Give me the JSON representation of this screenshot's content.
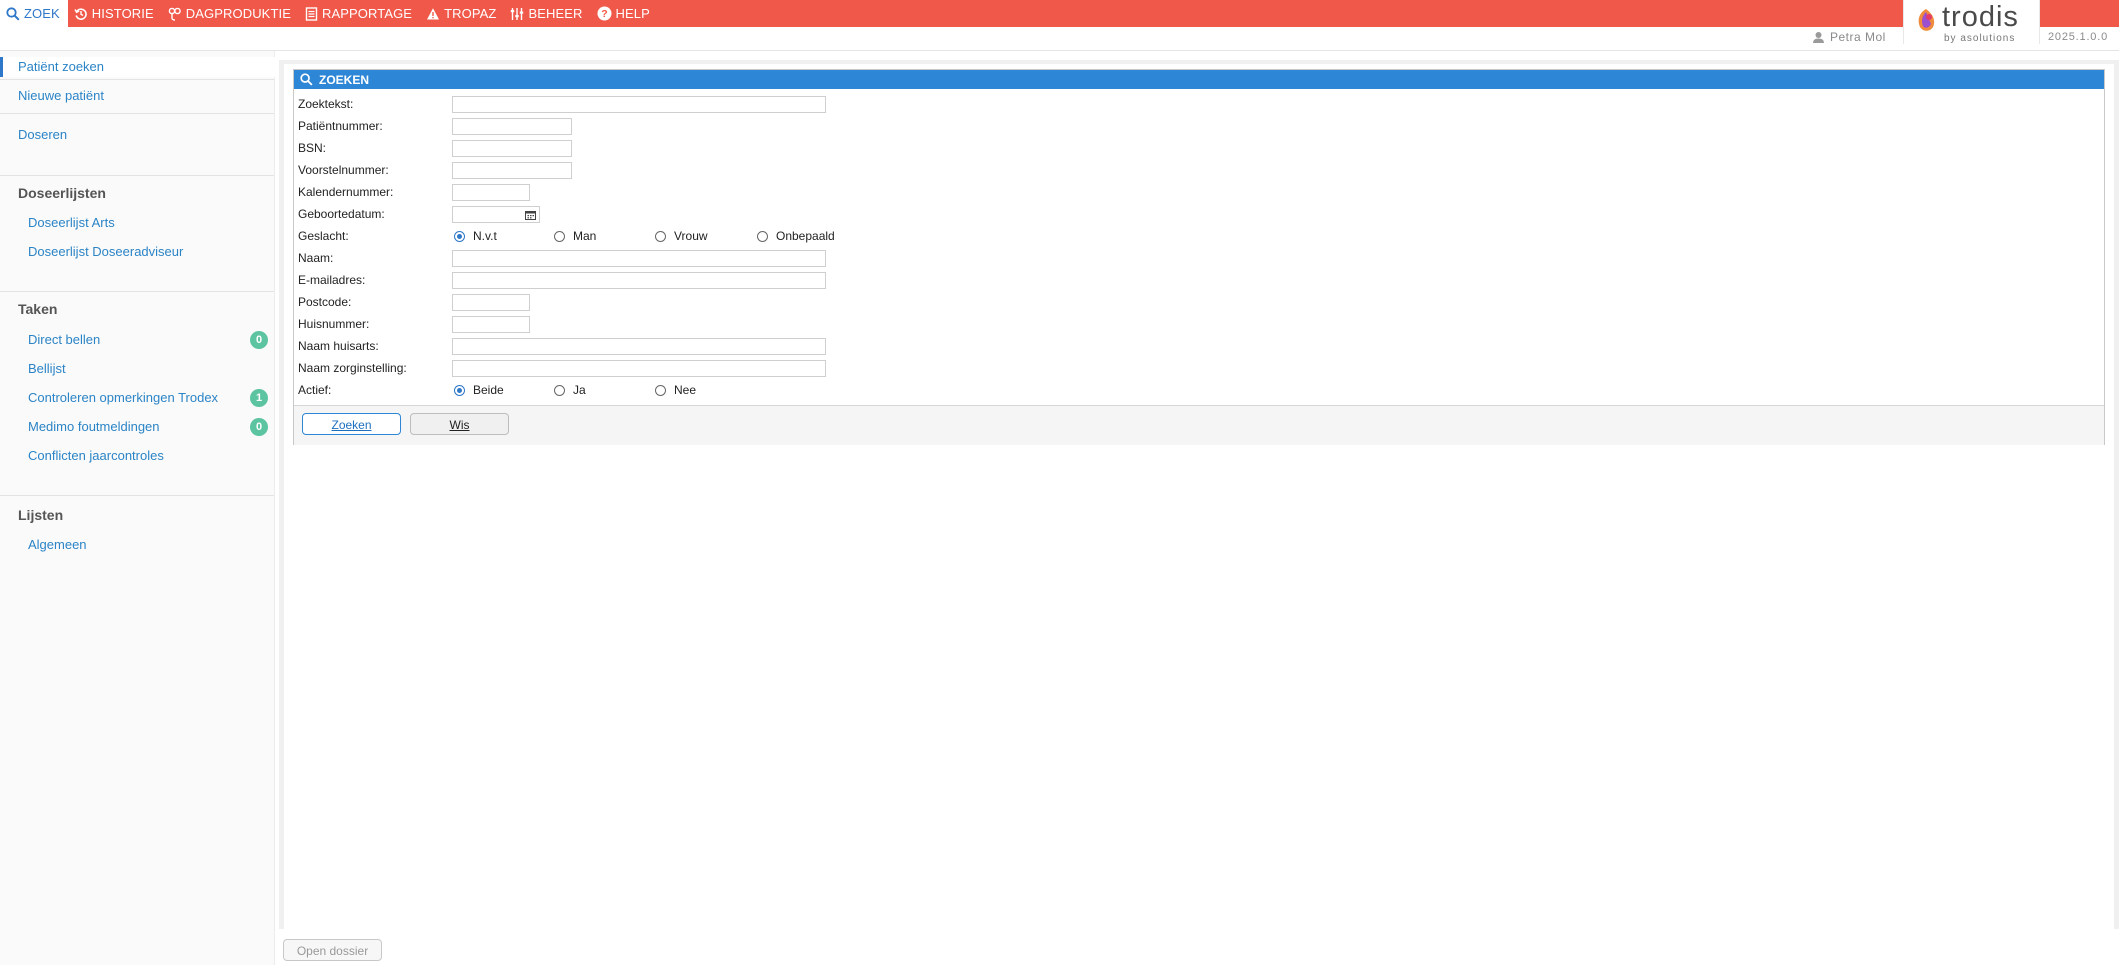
{
  "nav": {
    "items": [
      {
        "label": "ZOEK",
        "icon": "search-icon"
      },
      {
        "label": "HISTORIE",
        "icon": "history-icon"
      },
      {
        "label": "DAGPRODUKTIE",
        "icon": "production-icon"
      },
      {
        "label": "RAPPORTAGE",
        "icon": "report-icon"
      },
      {
        "label": "TROPAZ",
        "icon": "alert-icon"
      },
      {
        "label": "BEHEER",
        "icon": "sliders-icon"
      },
      {
        "label": "HELP",
        "icon": "help-icon"
      }
    ]
  },
  "brand": {
    "name": "trodis",
    "byline": "by asolutions",
    "color": "#f0584a",
    "accent": "#2e86d6"
  },
  "user": {
    "name": "Petra Mol"
  },
  "version": "2025.1.0.0",
  "sidebar": {
    "top": [
      {
        "label": "Patiënt zoeken"
      },
      {
        "label": "Nieuwe patiënt"
      },
      {
        "label": "Doseren"
      }
    ],
    "sections": [
      {
        "title": "Doseerlijsten",
        "items": [
          {
            "label": "Doseerlijst Arts"
          },
          {
            "label": "Doseerlijst Doseeradviseur"
          }
        ]
      },
      {
        "title": "Taken",
        "items": [
          {
            "label": "Direct bellen",
            "badge": "0"
          },
          {
            "label": "Bellijst"
          },
          {
            "label": "Controleren opmerkingen Trodex",
            "badge": "1"
          },
          {
            "label": "Medimo foutmeldingen",
            "badge": "0"
          },
          {
            "label": "Conflicten jaarcontroles"
          }
        ]
      },
      {
        "title": "Lijsten",
        "items": [
          {
            "label": "Algemeen"
          }
        ]
      }
    ]
  },
  "search": {
    "title": "ZOEKEN",
    "fields": [
      {
        "label": "Zoektekst:",
        "value": ""
      },
      {
        "label": "Patiëntnummer:",
        "value": ""
      },
      {
        "label": "BSN:",
        "value": ""
      },
      {
        "label": "Voorstelnummer:",
        "value": ""
      },
      {
        "label": "Kalendernummer:",
        "value": ""
      },
      {
        "label": "Geboortedatum:",
        "value": ""
      },
      {
        "label": "Geslacht:"
      },
      {
        "label": "Naam:",
        "value": ""
      },
      {
        "label": "E-mailadres:",
        "value": ""
      },
      {
        "label": "Postcode:",
        "value": ""
      },
      {
        "label": "Huisnummer:",
        "value": ""
      },
      {
        "label": "Naam huisarts:",
        "value": ""
      },
      {
        "label": "Naam zorginstelling:",
        "value": ""
      },
      {
        "label": "Actief:"
      }
    ],
    "gender_options": [
      "N.v.t",
      "Man",
      "Vrouw",
      "Onbepaald"
    ],
    "gender_selected": "N.v.t",
    "active_options": [
      "Beide",
      "Ja",
      "Nee"
    ],
    "active_selected": "Beide",
    "search_button": "Zoeken",
    "clear_button": "Wis"
  },
  "footer": {
    "open_dossier": "Open dossier"
  }
}
